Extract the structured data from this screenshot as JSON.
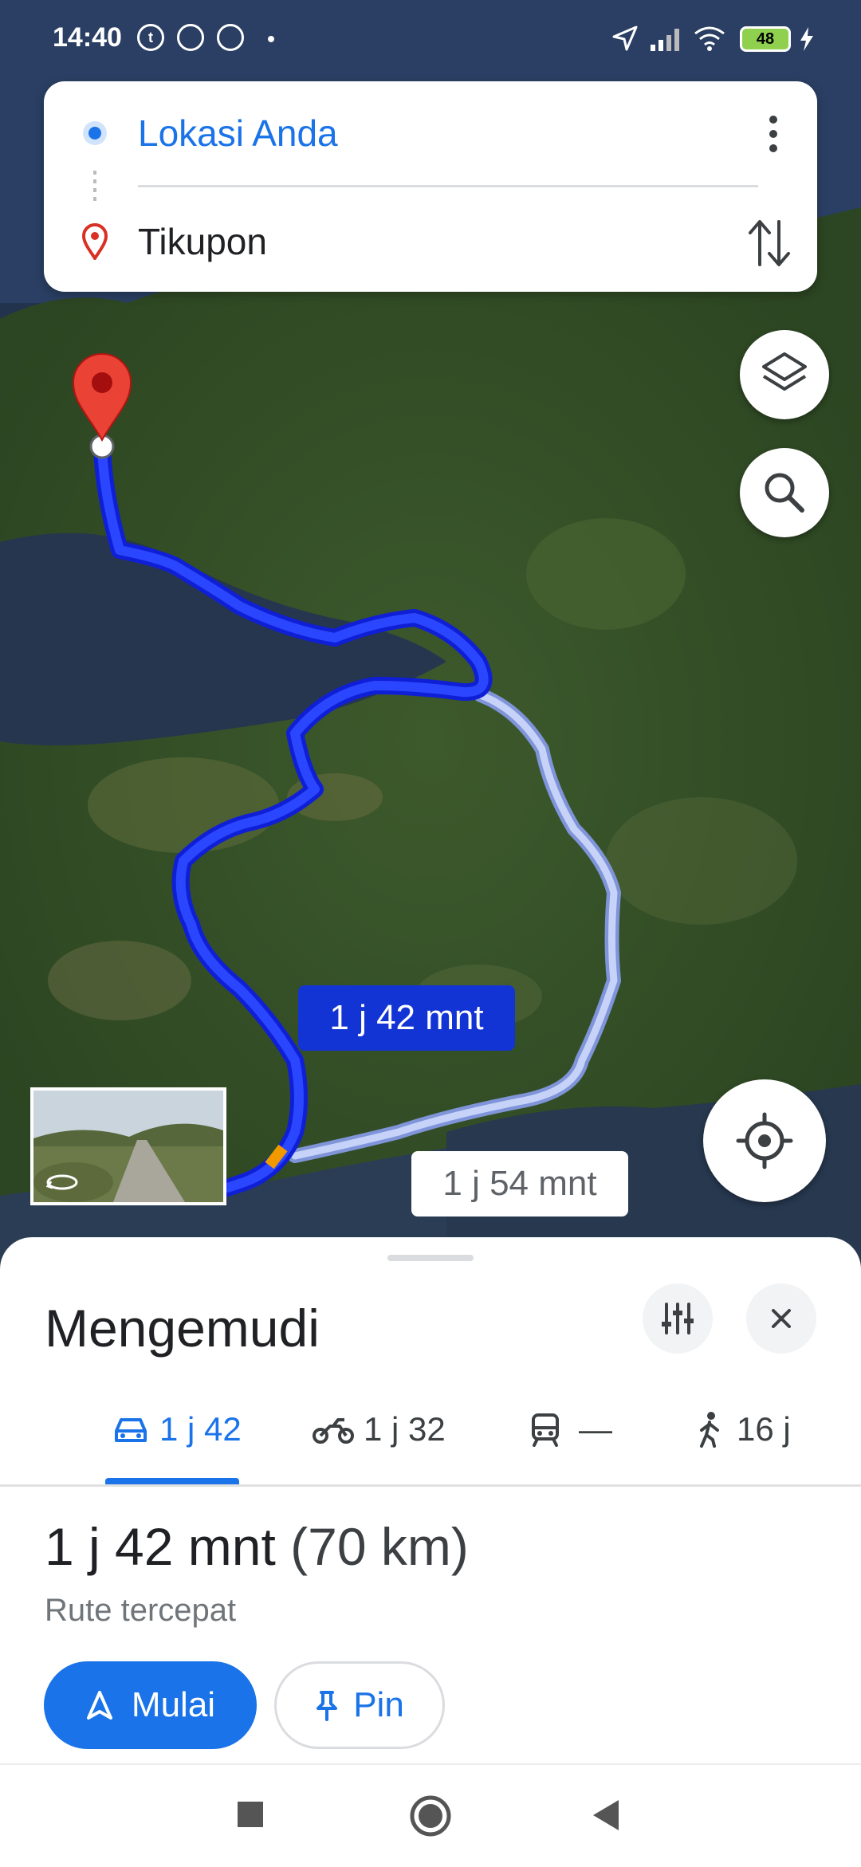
{
  "status_bar": {
    "time": "14:40",
    "battery_level": "48",
    "icons": [
      "t-notification-icon",
      "chrome-icon",
      "chrome-icon",
      "location-arrow-icon",
      "signal-icon",
      "wifi-icon",
      "battery-icon",
      "charging-icon"
    ]
  },
  "route_card": {
    "origin": "Lokasi Anda",
    "destination": "Tikupon"
  },
  "map": {
    "primary_route_label": "1 j 42 mnt",
    "alternate_route_label": "1 j 54 mnt",
    "colors": {
      "primary_route": "#1a3cf0",
      "alternate_route": "#b8c6f5",
      "marker": "#ea4335"
    }
  },
  "sheet": {
    "title": "Mengemudi",
    "modes": [
      {
        "icon": "car-icon",
        "label": "1 j 42",
        "active": true
      },
      {
        "icon": "motorcycle-icon",
        "label": "1 j 32",
        "active": false
      },
      {
        "icon": "transit-icon",
        "label": "—",
        "active": false
      },
      {
        "icon": "walk-icon",
        "label": "16 j",
        "active": false
      }
    ],
    "duration": "1 j 42 mnt",
    "distance": "(70 km)",
    "route_description": "Rute tercepat",
    "start_label": "Mulai",
    "pin_label": "Pin"
  },
  "colors": {
    "accent": "#1a73e8"
  }
}
